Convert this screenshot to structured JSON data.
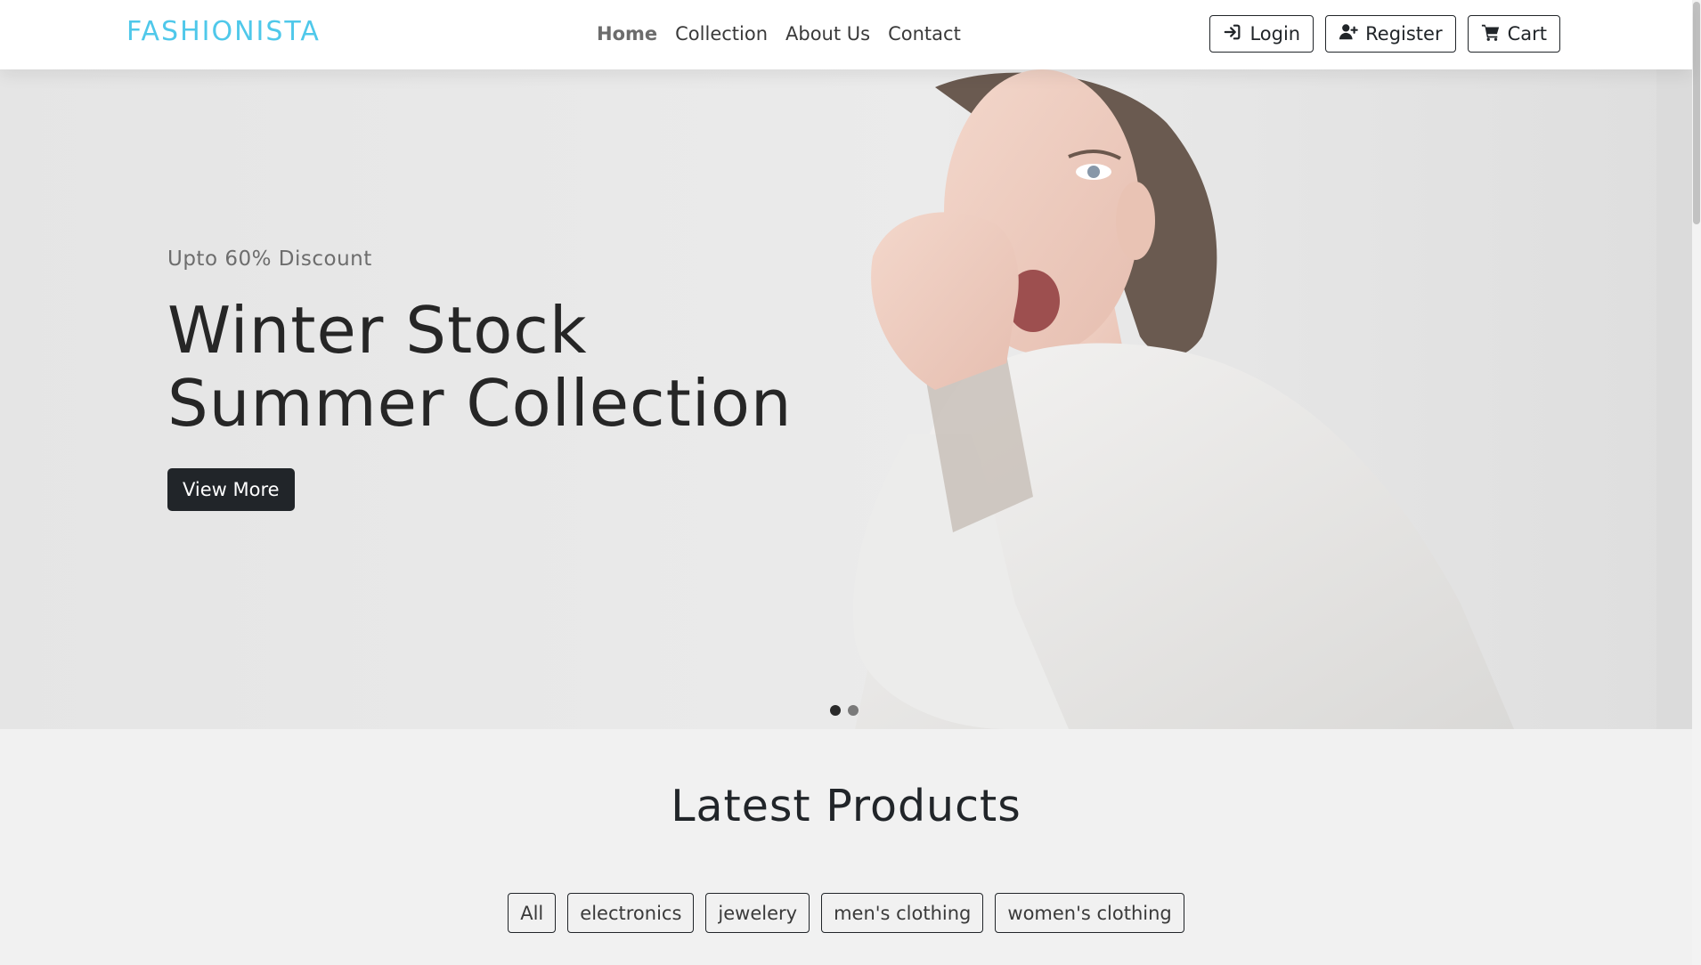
{
  "nav": {
    "brand": "FASHIONISTA",
    "links": [
      "Home",
      "Collection",
      "About Us",
      "Contact"
    ],
    "active_link": "Home",
    "login_label": "Login",
    "register_label": "Register",
    "cart_label": "Cart"
  },
  "hero": {
    "kicker": "Upto 60% Discount",
    "title": "Winter Stock Summer Collection",
    "cta_label": "View More",
    "slides_total": 2,
    "active_slide": 1
  },
  "products": {
    "title": "Latest Products",
    "filters": [
      "All",
      "electronics",
      "jewelery",
      "men's clothing",
      "women's clothing"
    ]
  },
  "colors": {
    "brand": "#4fc8ea",
    "dark": "#212529"
  }
}
